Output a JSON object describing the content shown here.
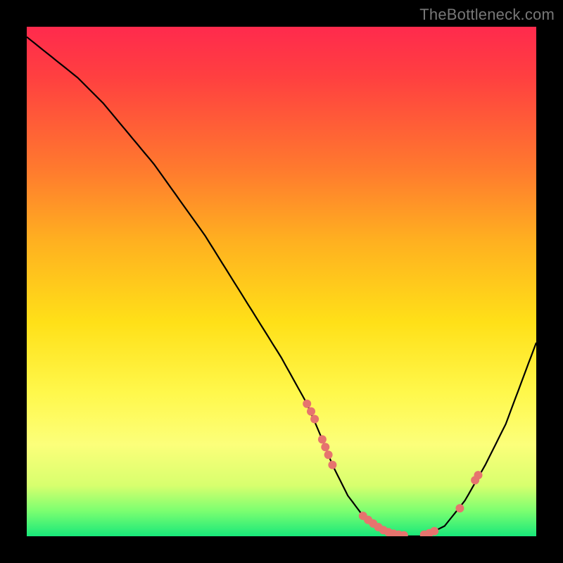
{
  "watermark": "TheBottleneck.com",
  "chart_data": {
    "type": "line",
    "title": "",
    "xlabel": "",
    "ylabel": "",
    "xlim": [
      0,
      100
    ],
    "ylim": [
      0,
      100
    ],
    "curve": {
      "x": [
        0,
        5,
        10,
        15,
        20,
        25,
        30,
        35,
        40,
        45,
        50,
        55,
        58,
        60,
        63,
        66,
        70,
        74,
        78,
        82,
        86,
        90,
        94,
        97,
        100
      ],
      "y": [
        98,
        94,
        90,
        85,
        79,
        73,
        66,
        59,
        51,
        43,
        35,
        26,
        19,
        14,
        8,
        4,
        1,
        0,
        0,
        2,
        7,
        14,
        22,
        30,
        38
      ]
    },
    "markers": [
      {
        "x": 55.0,
        "y": 26.0
      },
      {
        "x": 55.8,
        "y": 24.5
      },
      {
        "x": 56.5,
        "y": 23.0
      },
      {
        "x": 58.0,
        "y": 19.0
      },
      {
        "x": 58.6,
        "y": 17.5
      },
      {
        "x": 59.2,
        "y": 16.0
      },
      {
        "x": 60.0,
        "y": 14.0
      },
      {
        "x": 66.0,
        "y": 4.0
      },
      {
        "x": 67.0,
        "y": 3.2
      },
      {
        "x": 68.0,
        "y": 2.5
      },
      {
        "x": 69.0,
        "y": 1.8
      },
      {
        "x": 70.0,
        "y": 1.2
      },
      {
        "x": 71.0,
        "y": 0.8
      },
      {
        "x": 72.0,
        "y": 0.5
      },
      {
        "x": 73.0,
        "y": 0.3
      },
      {
        "x": 74.0,
        "y": 0.2
      },
      {
        "x": 78.0,
        "y": 0.3
      },
      {
        "x": 79.0,
        "y": 0.6
      },
      {
        "x": 80.0,
        "y": 1.0
      },
      {
        "x": 85.0,
        "y": 5.5
      },
      {
        "x": 88.0,
        "y": 11.0
      },
      {
        "x": 88.6,
        "y": 12.0
      }
    ],
    "colors": {
      "curve": "#000000",
      "marker": "#e6746e"
    }
  }
}
